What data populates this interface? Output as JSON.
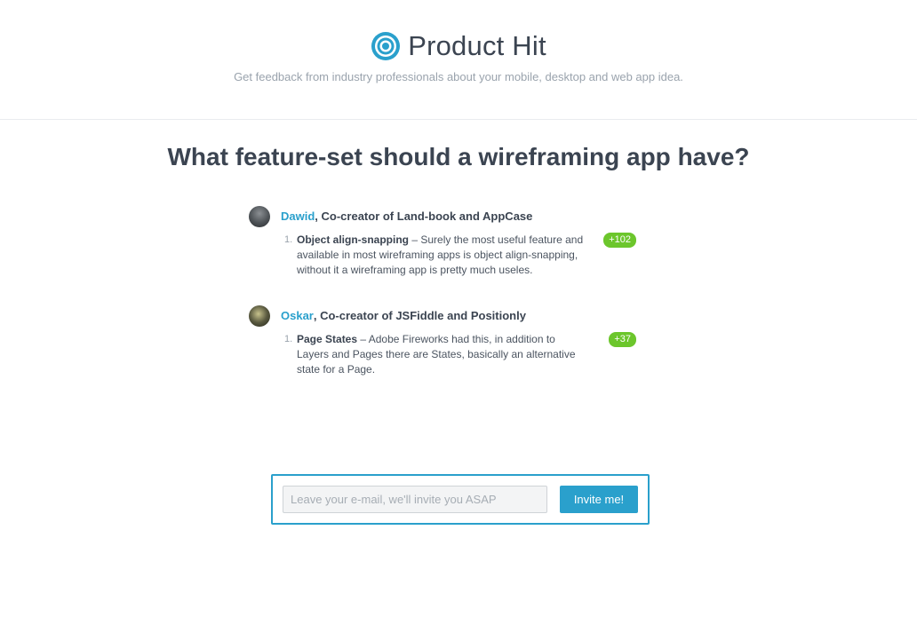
{
  "header": {
    "brand_name": "Product Hit",
    "tagline": "Get feedback from industry professionals about your mobile, desktop and web app idea.",
    "logo_icon": "concentric-circles-icon",
    "accent_color": "#2aa0cc"
  },
  "question": {
    "title": "What feature-set should a wireframing app have?"
  },
  "answers": [
    {
      "author": "Dawid",
      "role": ", Co-creator of Land-book and AppCase",
      "number": "1.",
      "feature": "Object align-snapping",
      "text": " – Surely the most useful feature and available in most wireframing apps is object align-snapping, without it a wireframing app is pretty much useles.",
      "votes": "+102"
    },
    {
      "author": "Oskar",
      "role": ", Co-creator of JSFiddle and Positionly",
      "number": "1.",
      "feature": "Page States",
      "text": " – Adobe Fireworks had this, in addition to Layers and Pages there are States, basically an alternative state for a Page.",
      "votes": "+37"
    }
  ],
  "signup": {
    "email_placeholder": "Leave your e-mail, we'll invite you ASAP",
    "email_value": "",
    "button_label": "Invite me!"
  },
  "colors": {
    "vote_badge": "#6cc62c",
    "text_dark": "#3b4451",
    "text_muted": "#9aa3ad"
  }
}
